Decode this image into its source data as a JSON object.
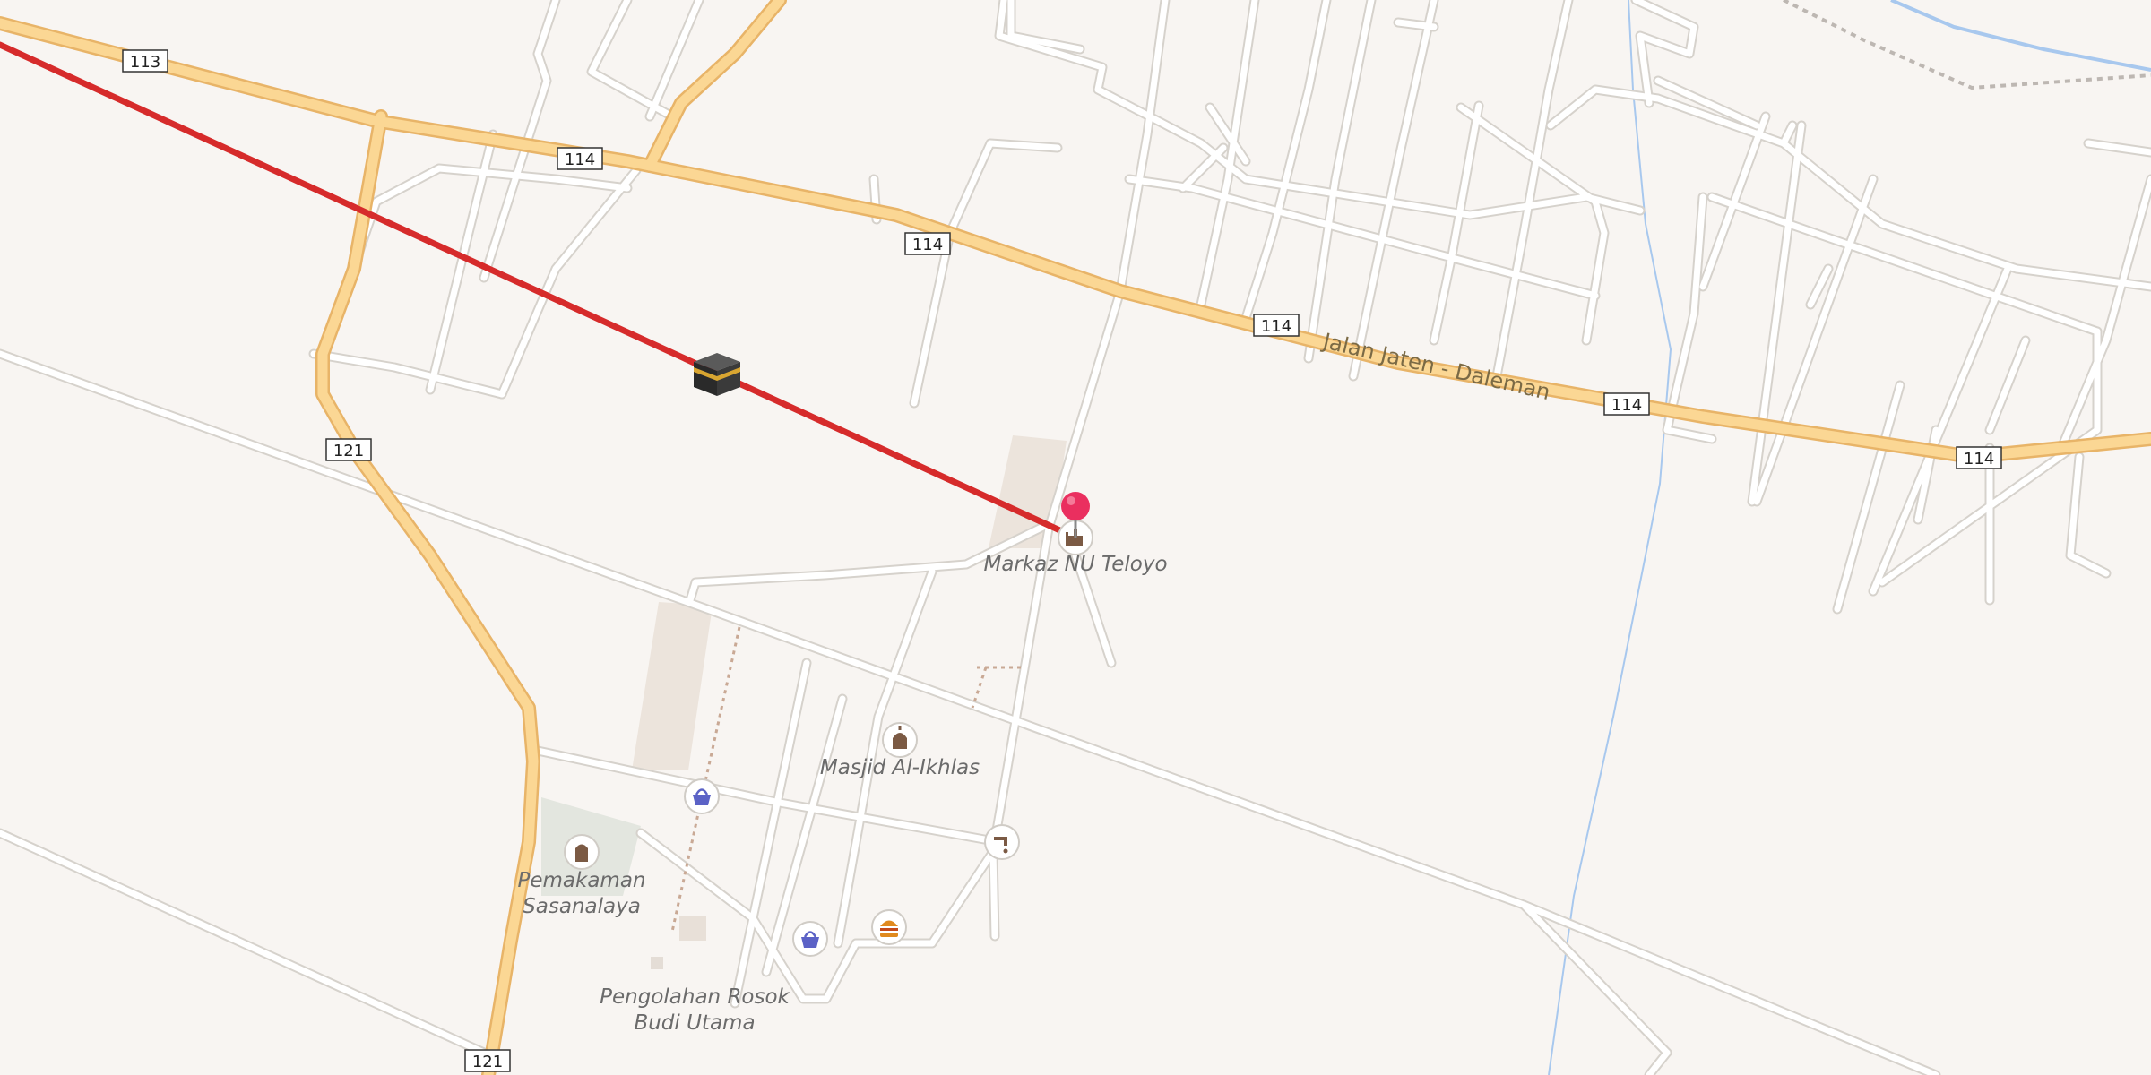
{
  "map": {
    "road_shields": [
      "113",
      "114",
      "114",
      "114",
      "114",
      "114",
      "121",
      "121"
    ],
    "street_name": "Jalan Jaten - Daleman",
    "places": [
      {
        "name": "Markaz NU Teloyo",
        "icon": "mosque-icon"
      },
      {
        "name": "Masjid Al-Ikhlas",
        "icon": "mosque-icon"
      },
      {
        "name_lines": [
          "Pemakaman",
          "Sasanalaya"
        ],
        "icon": "cemetery-icon"
      },
      {
        "name_lines": [
          "Pengolahan Rosok",
          "Budi Utama"
        ]
      }
    ],
    "poi_icons": [
      "shop-basket-icon",
      "shop-basket-icon",
      "fast-food-icon",
      "water-tap-icon"
    ],
    "markers": [
      "kaaba-icon",
      "location-pin-icon"
    ],
    "colors": {
      "background": "#f8f5f2",
      "primary_road": "#fbd794",
      "primary_road_casing": "#e8b468",
      "minor_road": "#ffffff",
      "minor_road_casing": "#d6d2cc",
      "qibla_line": "#d62b2b",
      "pin": "#ea2f5f",
      "water": "#9fc4ea"
    }
  }
}
